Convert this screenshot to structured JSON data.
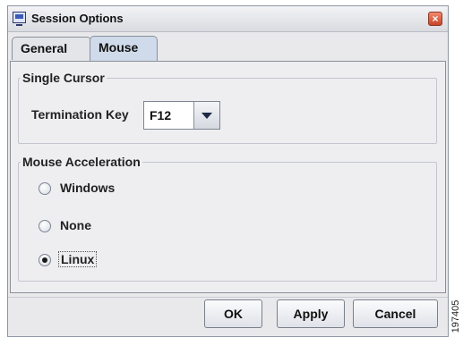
{
  "window": {
    "title": "Session Options",
    "icon": "monitor-icon",
    "close_icon": "close-icon"
  },
  "tabs": [
    {
      "label": "General",
      "selected": false
    },
    {
      "label": "Mouse",
      "selected": true
    }
  ],
  "single_cursor": {
    "legend": "Single Cursor",
    "termination_label": "Termination Key",
    "termination_value": "F12"
  },
  "mouse_acceleration": {
    "legend": "Mouse Acceleration",
    "options": [
      {
        "label": "Windows",
        "checked": false
      },
      {
        "label": "None",
        "checked": false
      },
      {
        "label": "Linux",
        "checked": true
      }
    ]
  },
  "buttons": {
    "ok": "OK",
    "apply": "Apply",
    "cancel": "Cancel"
  },
  "figure_id": "197405",
  "colors": {
    "selected_tab": "#cfdaea",
    "close_button": "#d9583a"
  }
}
